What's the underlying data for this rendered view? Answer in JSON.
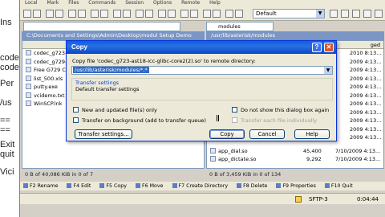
{
  "background_doc": {
    "lines": [
      "Ins",
      "",
      "codec",
      "codec",
      "",
      "Per",
      "/us",
      "",
      "==",
      "==",
      "",
      "Exit",
      "quit",
      "",
      "Vici"
    ]
  },
  "menubar": {
    "items": [
      "Local",
      "Mark",
      "Files",
      "Commands",
      "Session",
      "Options",
      "Remote",
      "Help"
    ]
  },
  "toolbar": {
    "session_selected": "Default",
    "remote_dir": "modules"
  },
  "left_panel": {
    "path": "C:\\Documents and Settings\\Admin\\Desktop\\modul Setup Demo",
    "files": [
      {
        "name": "codec_g723-ast..."
      },
      {
        "name": "codec_g729-ast..."
      },
      {
        "name": "Free G729 Cod..."
      },
      {
        "name": "list_500.xls"
      },
      {
        "name": "putty.exe"
      },
      {
        "name": "vcidemo.txt"
      },
      {
        "name": "WinSCP.lnk"
      }
    ],
    "status": "0 B of 40,086 KiB in 0 of 7"
  },
  "right_panel": {
    "path": "/usr/lib/asterisk/modules",
    "header_fragment": "ged",
    "rows": [
      {
        "name": "",
        "size": "",
        "date": "2010 8:13..."
      },
      {
        "name": "",
        "size": "",
        "date": "2009 4:13..."
      },
      {
        "name": "",
        "size": "",
        "date": "2009 4:13..."
      },
      {
        "name": "",
        "size": "",
        "date": "2009 4:13..."
      },
      {
        "name": "",
        "size": "",
        "date": "2009 4:13..."
      },
      {
        "name": "",
        "size": "",
        "date": "2009 4:13..."
      },
      {
        "name": "",
        "size": "",
        "date": "2009 4:13..."
      },
      {
        "name": "",
        "size": "",
        "date": "2009 4:13..."
      },
      {
        "name": "",
        "size": "",
        "date": "2009 4:13..."
      },
      {
        "name": "",
        "size": "",
        "date": "2009 4:13..."
      },
      {
        "name": "",
        "size": "",
        "date": "2009 4:13..."
      },
      {
        "name": "app_dial.so",
        "size": "45,400",
        "date": "7/10/2009 4:13..."
      },
      {
        "name": "app_dictate.so",
        "size": "9,292",
        "date": "7/10/2009 4:13..."
      }
    ],
    "status": "0 B of 3,459 KiB in 0 of 134"
  },
  "function_keys": [
    "F2 Rename",
    "F4 Edit",
    "F5 Copy",
    "F6 Move",
    "F7 Create Directory",
    "F8 Delete",
    "F9 Properties",
    "F10 Quit"
  ],
  "statusbar": {
    "protocol": "SFTP-3",
    "time": "0:04:44"
  },
  "dialog": {
    "title": "Copy",
    "prompt": "Copy file 'codec_g723-ast18-icc-glibc-core2(2).so' to remote directory:",
    "target": "/usr/lib/asterisk/modules/*.*",
    "group_title": "Transfer settings",
    "group_text": "Default transfer settings",
    "chk_new_updated": "New and updated file(s) only",
    "chk_no_show": "Do not show this dialog box again",
    "chk_background": "Transfer on background (add to transfer queue)",
    "chk_each_file": "Transfer each file individually",
    "btn_transfer_settings": "Transfer settings...",
    "btn_copy": "Copy",
    "btn_cancel": "Cancel",
    "btn_help": "Help",
    "help_glyph": "?",
    "close_glyph": "✕"
  }
}
